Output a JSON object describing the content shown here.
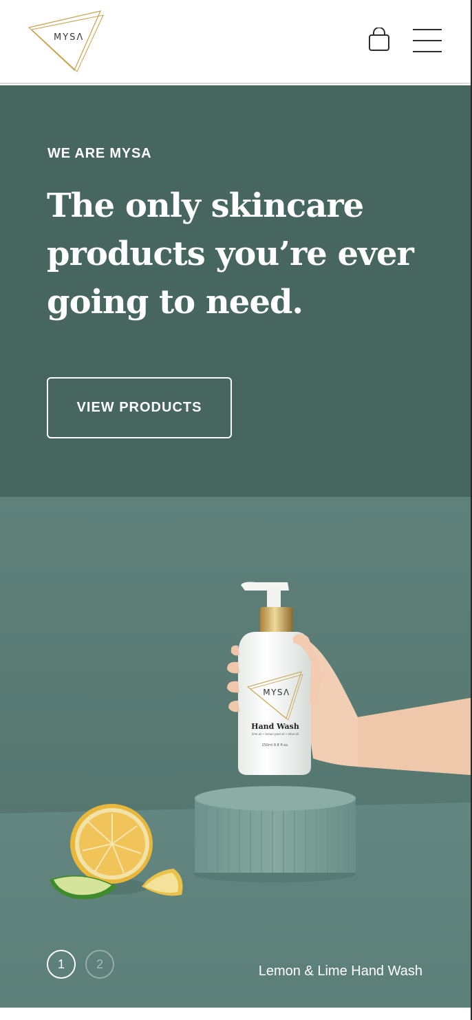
{
  "header": {
    "logo_text": "MYSΛ",
    "cart_icon": "shopping-bag-icon",
    "menu_icon": "hamburger-menu-icon"
  },
  "hero": {
    "eyebrow": "WE ARE MYSA",
    "headline": "The only skincare products you’re ever going to need.",
    "cta_label": "VIEW PRODUCTS",
    "background": "#46665f"
  },
  "product": {
    "bottle_brand": "MYSΛ",
    "bottle_product": "Hand Wash",
    "bottle_ingredients": "lime oil • lemon peel oil • olive oil",
    "bottle_volume": "250ml 8.8 fl.oz.",
    "caption": "Lemon & Lime Hand Wash",
    "pager": {
      "pages": [
        "1",
        "2"
      ],
      "current": "1"
    },
    "background": "#5b7d76"
  }
}
